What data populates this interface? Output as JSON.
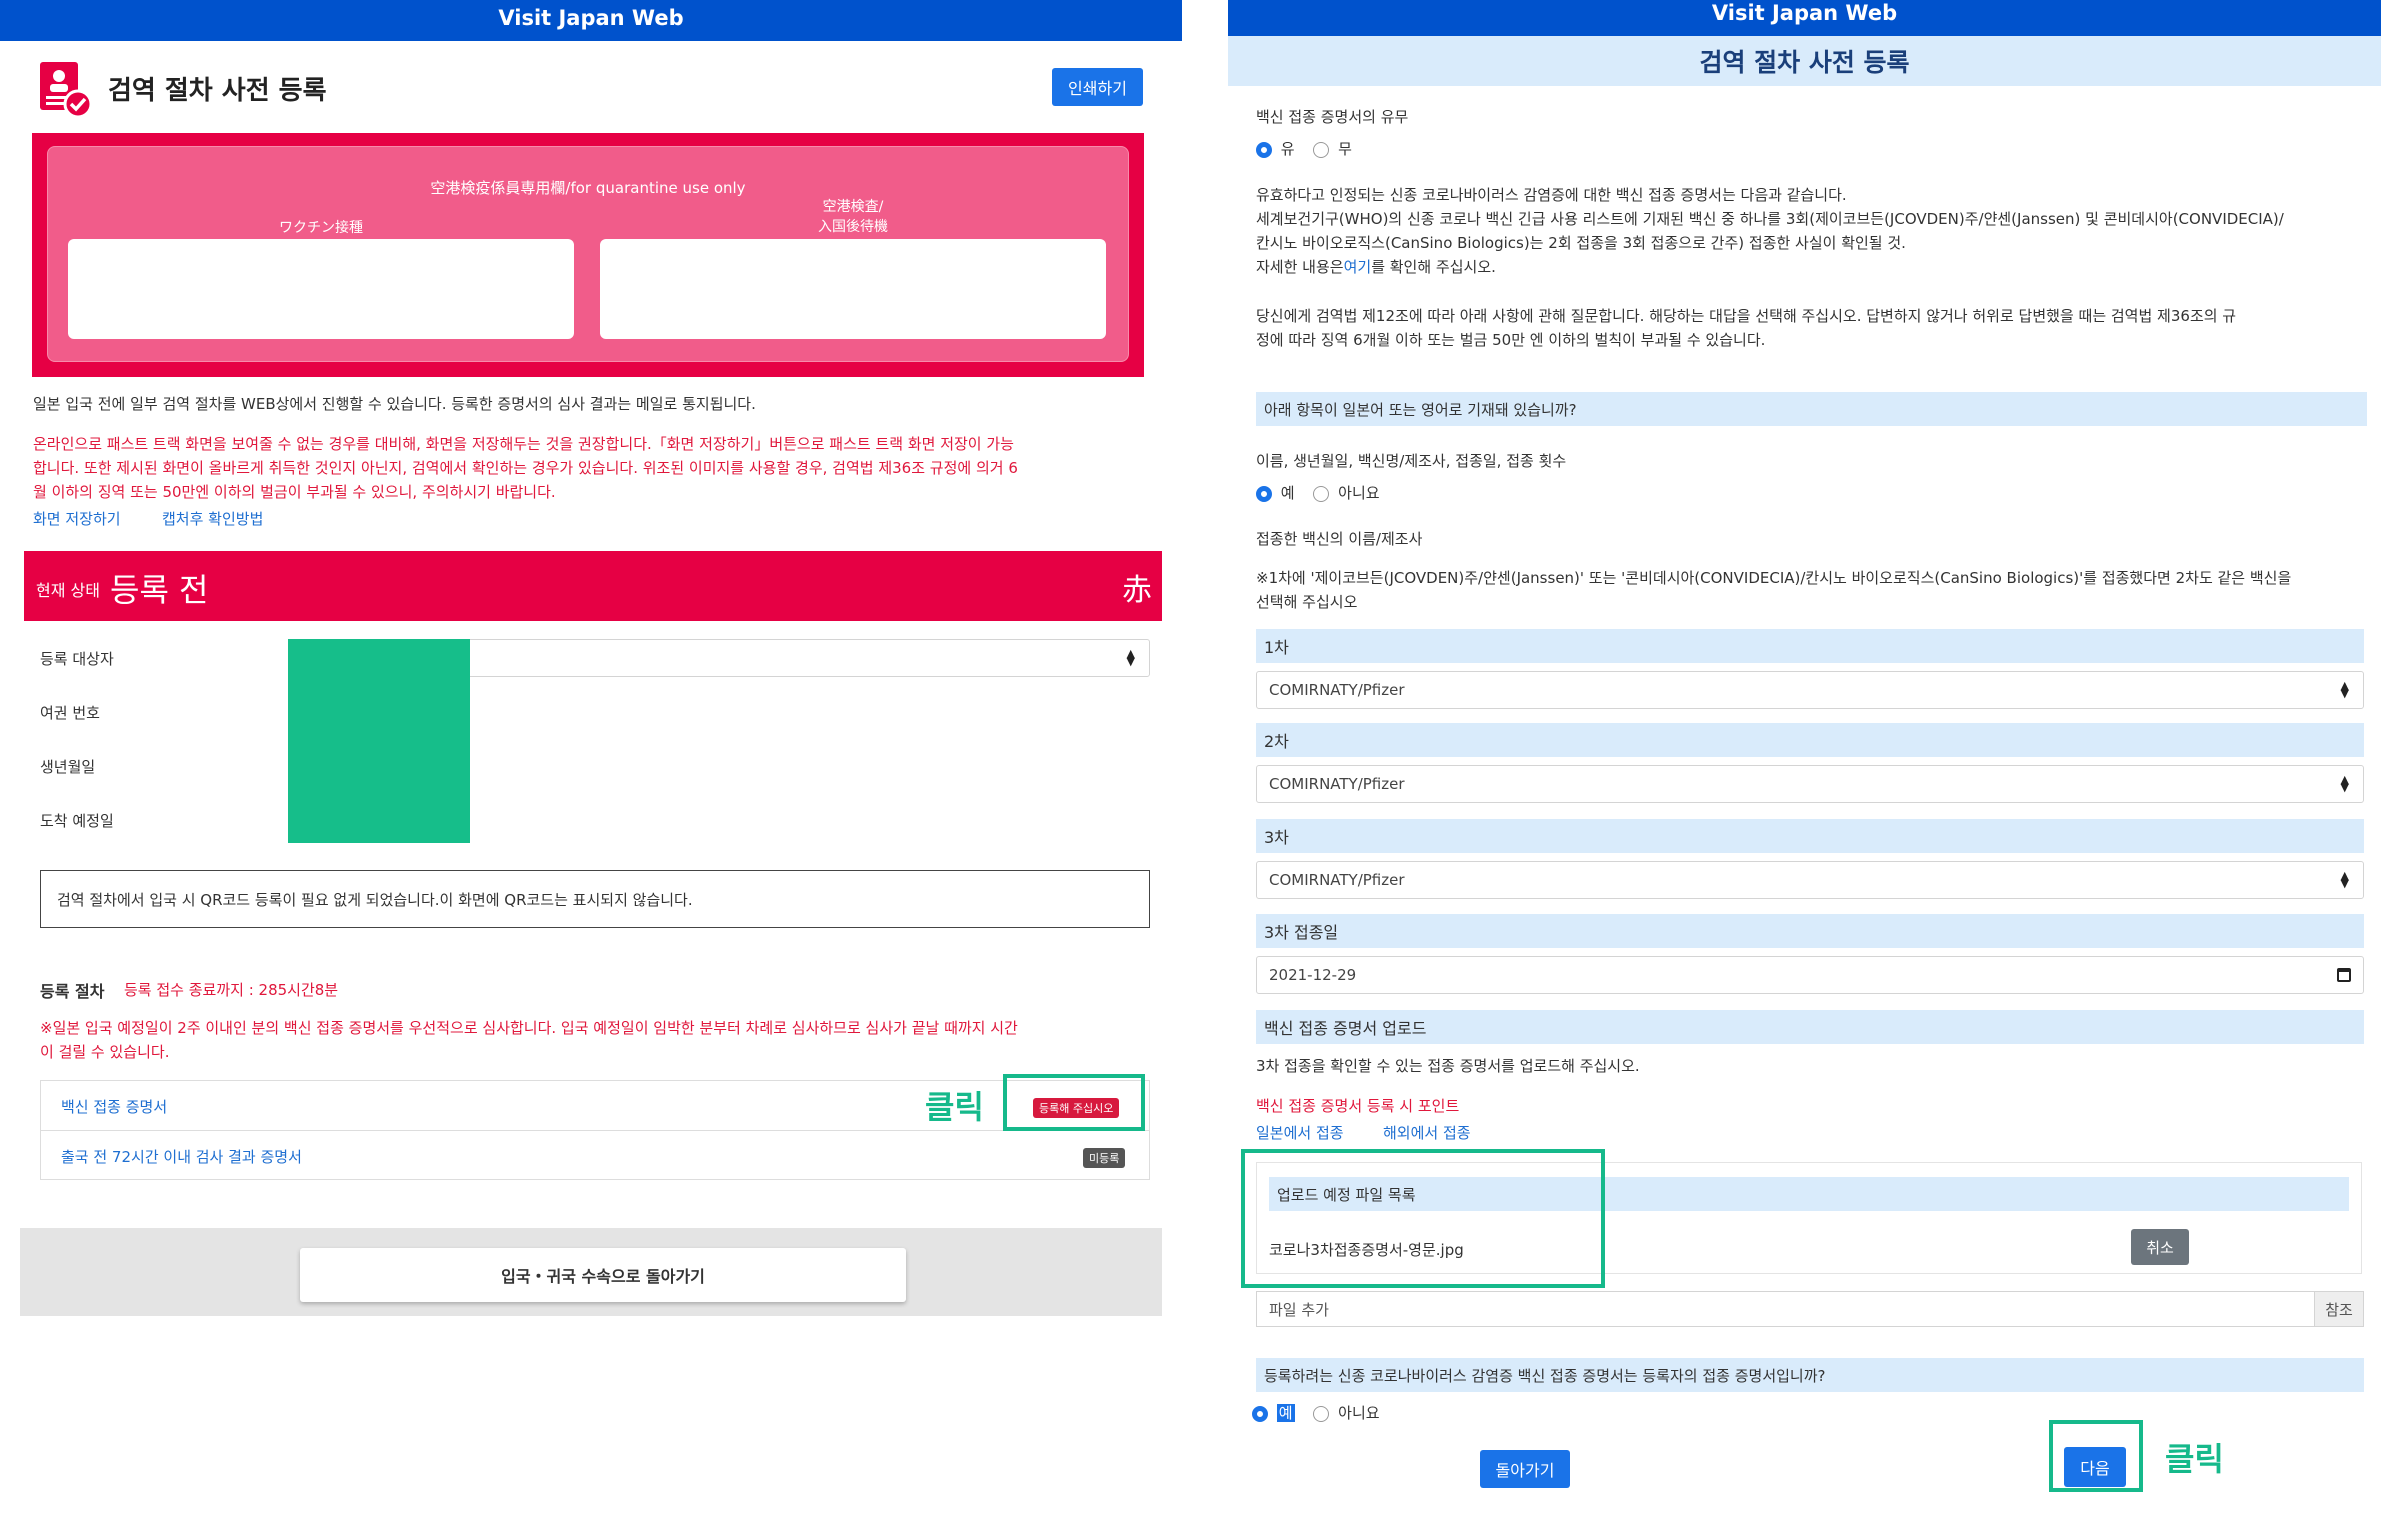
{
  "left": {
    "app_title": "Visit Japan Web",
    "page_title": "검역 절차 사전 등록",
    "print_label": "인쇄하기",
    "quarantine": {
      "heading": "空港検疫係員専用欄/for quarantine use only",
      "box1_label": "ワクチン接種",
      "box2_label_line1": "空港検査/",
      "box2_label_line2": "入国後待機"
    },
    "intro": "일본 입국 전에 일부 검역 절차를 WEB상에서 진행할 수 있습니다. 등록한 증명서의 심사 결과는 메일로 통지됩니다.",
    "warning_line1": "온라인으로 패스트 트랙 화면을 보여줄 수 없는 경우를 대비해, 화면을 저장해두는 것을 권장합니다.「화면 저장하기」버튼으로 패스트 트랙 화면 저장이 가능",
    "warning_line2": "합니다. 또한 제시된 화면이 올바르게 취득한 것인지 아닌지, 검역에서 확인하는 경우가 있습니다. 위조된 이미지를 사용할 경우, 검역법 제36조 규정에 의거 6",
    "warning_line3": "월 이하의 징역 또는 50만엔 이하의 벌금이 부과될 수 있으니, 주의하시기 바랍니다.",
    "save_screen_link": "화면 저장하기",
    "capture_link": "캡처후 확인방법",
    "status": {
      "label": "현재 상태",
      "value": "등록 전",
      "badge": "赤"
    },
    "fields": {
      "target": "등록 대상자",
      "passport": "여권 번호",
      "birth": "생년월일",
      "arrival": "도착 예정일"
    },
    "qr_notice": "검역 절차에서 입국 시 QR코드 등록이 필요 없게 되었습니다.이 화면에 QR코드는 표시되지 않습니다.",
    "procedure_label": "등록 절차",
    "deadline": "등록 접수 종료까지 : 285시간8분",
    "priority_line1": "※일본 입국 예정일이 2주 이내인 분의 백신 접종 증명서를 우선적으로 심사합니다. 입국 예정일이 임박한 분부터 차례로 심사하므로 심사가 끝날 때까지 시간",
    "priority_line2": "이 걸릴 수 있습니다.",
    "items": [
      {
        "label": "백신 접종 증명서",
        "badge": "등록해 주십시오"
      },
      {
        "label": "출국 전 72시간 이내 검사 결과 증명서",
        "badge": "미등록"
      }
    ],
    "annotation_click": "클릭",
    "back_button": "입국・귀국 수속으로 돌아가기"
  },
  "right": {
    "app_title": "Visit Japan Web",
    "page_title": "검역 절차 사전 등록",
    "cert_exists_q": "백신 접종 증명서의 유무",
    "opt_yes": "유",
    "opt_no": "무",
    "valid_line1": "유효하다고 인정되는 신종 코로나바이러스 감염증에 대한 백신 접종 증명서는 다음과 같습니다.",
    "valid_line2": "세계보건기구(WHO)의 신종 코로나 백신 긴급 사용 리스트에 기재된 백신 중 하나를 3회(제이코브든(JCOVDEN)주/얀센(Janssen) 및 콘비데시아(CONVIDECIA)/",
    "valid_line3": "칸시노 바이오로직스(CanSino Biologics)는 2회 접종을 3회 접종으로 간주) 접종한 사실이 확인될 것.",
    "valid_line4_pre": "자세한 내용은",
    "valid_link": "여기",
    "valid_line4_post": "를 확인해 주십시오.",
    "quarantine_line1": "당신에게 검역법 제12조에 따라 아래 사항에 관해 질문합니다. 해당하는 대답을 선택해 주십시오. 답변하지 않거나 허위로 답변했을 때는 검역법 제36조의 규",
    "quarantine_line2": "정에 따라 징역 6개월 이하 또는 벌금 50만 엔 이하의 벌칙이 부과될 수 있습니다.",
    "lang_q": "아래 항목이 일본어 또는 영어로 기재돼 있습니까?",
    "lang_items": "이름, 생년월일, 백신명/제조사, 접종일, 접종 횟수",
    "opt_ye": "예",
    "opt_aniyo": "아니요",
    "vaccine_name_label": "접종한 백신의 이름/제조사",
    "vaccine_note_line1": "※1차에 '제이코브든(JCOVDEN)주/얀센(Janssen)' 또는 '콘비데시아(CONVIDECIA)/칸시노 바이오로직스(CanSino Biologics)'를 접종했다면 2차도 같은 백신을",
    "vaccine_note_line2": "선택해 주십시오",
    "dose1_label": "1차",
    "dose1_value": "COMIRNATY/Pfizer",
    "dose2_label": "2차",
    "dose2_value": "COMIRNATY/Pfizer",
    "dose3_label": "3차",
    "dose3_value": "COMIRNATY/Pfizer",
    "dose3_date_label": "3차 접종일",
    "dose3_date_value": "2021-12-29",
    "upload_label": "백신 접종 증명서 업로드",
    "upload_desc": "3차 접종을 확인할 수 있는 접종 증명서를 업로드해 주십시오.",
    "upload_points_link": "백신 접종 증명서 등록 시 포인트",
    "japan_link": "일본에서 접종",
    "abroad_link": "해외에서 접종",
    "file_list_header": "업로드 예정 파일 목록",
    "file_name": "코로나3차접종증명서-영문.jpg",
    "cancel_button": "취소",
    "add_file_placeholder": "파일 추가",
    "browse_button": "참조",
    "owner_q": "등록하려는 신종 코로나바이러스 감염증 백신 접종 증명서는 등록자의 접종 증명서입니까?",
    "back_button": "돌아가기",
    "next_button": "다음",
    "annotation_click": "클릭"
  },
  "colors": {
    "header_blue": "#0052cc",
    "status_red": "#e60044",
    "annotation_green": "#16b98b",
    "link_blue": "#1f6fd1",
    "band_blue": "#d9ebfb"
  }
}
